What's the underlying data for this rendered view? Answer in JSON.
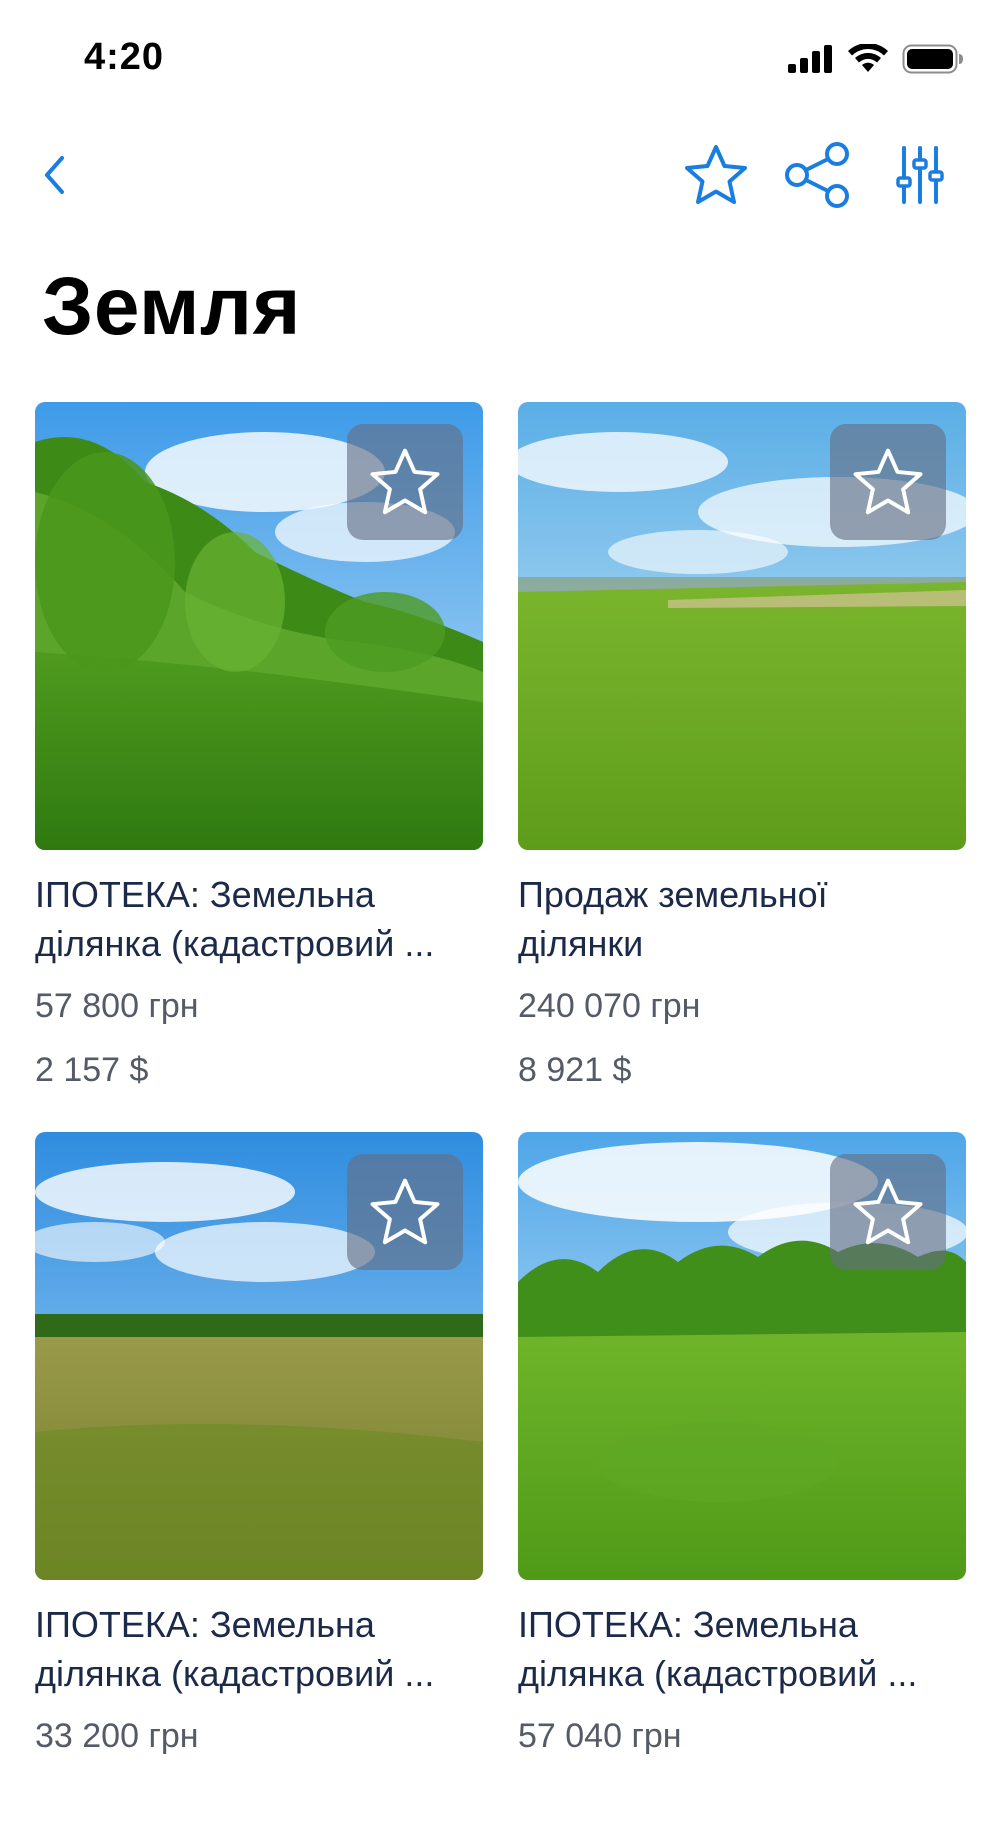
{
  "status_bar": {
    "time": "4:20"
  },
  "nav": {
    "back_icon": "chevron-left-icon",
    "favorite_icon": "star-icon",
    "share_icon": "share-icon",
    "filter_icon": "sliders-icon",
    "accent_color": "#1a7de0"
  },
  "page": {
    "title": "Земля"
  },
  "listings": [
    {
      "title_line1": "ІПОТЕКА: Земельна",
      "title_line2": "ділянка (кадастровий ...",
      "price_uah": "57 800 грн",
      "price_usd": "2 157 $",
      "favorite_icon": "star-icon"
    },
    {
      "title_line1": "Продаж земельної",
      "title_line2": "ділянки",
      "price_uah": "240 070 грн",
      "price_usd": "8 921 $",
      "favorite_icon": "star-icon"
    },
    {
      "title_line1": "ІПОТЕКА: Земельна",
      "title_line2": "ділянка (кадастровий ...",
      "price_uah": "33 200 грн",
      "price_usd": "",
      "favorite_icon": "star-icon"
    },
    {
      "title_line1": "ІПОТЕКА: Земельна",
      "title_line2": "ділянка (кадастровий ...",
      "price_uah": "57 040 грн",
      "price_usd": "",
      "favorite_icon": "star-icon"
    }
  ]
}
